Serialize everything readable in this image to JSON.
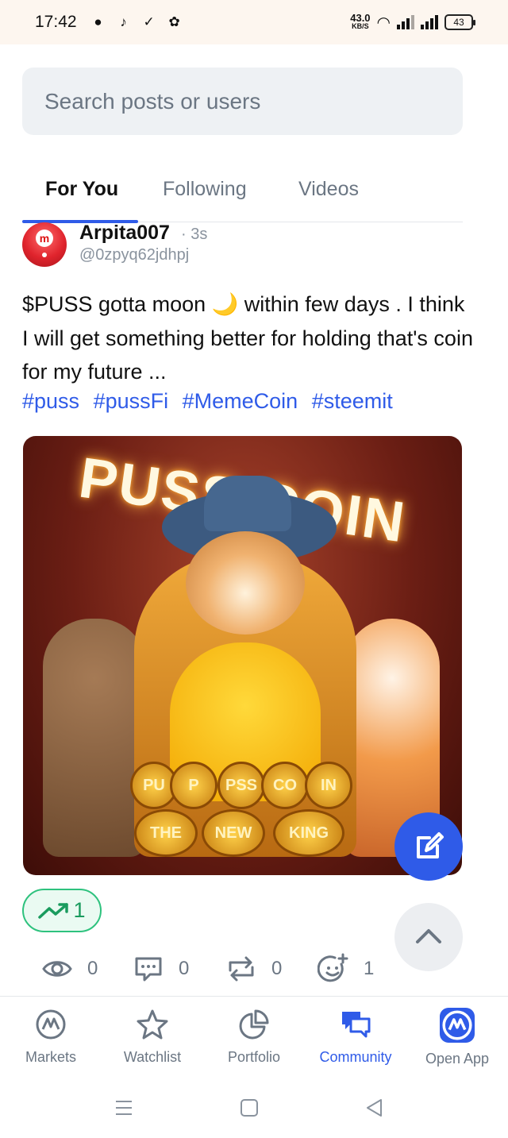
{
  "status_bar": {
    "time": "17:42",
    "net_speed": "43.0",
    "net_unit": "KB/S",
    "battery": "43"
  },
  "search": {
    "placeholder": "Search posts or users"
  },
  "tabs": [
    {
      "label": "For You",
      "active": true
    },
    {
      "label": "Following",
      "active": false
    },
    {
      "label": "Videos",
      "active": false
    }
  ],
  "post": {
    "author": "Arpita007",
    "time": "· 3s",
    "handle": "@0zpyq62jdhpj",
    "text": "$PUSS gotta moon 🌙 within few days . I think I will get something better for holding that's coin for my future ...",
    "hashtags": [
      "#puss",
      "#pussFi",
      "#MemeCoin",
      "#steemit"
    ],
    "image_text": {
      "title": "PUSS COIN",
      "coin_row1": [
        "PU",
        "P",
        "PSS",
        "CO",
        "IN"
      ],
      "coin_row2": [
        "THE",
        "NEW",
        "KING"
      ]
    },
    "trend_count": "1",
    "stats": {
      "views": "0",
      "comments": "0",
      "reposts": "0",
      "reactions": "1"
    }
  },
  "bottom_nav": [
    {
      "label": "Markets",
      "icon": "markets-icon",
      "active": false
    },
    {
      "label": "Watchlist",
      "icon": "star-icon",
      "active": false
    },
    {
      "label": "Portfolio",
      "icon": "pie-chart-icon",
      "active": false
    },
    {
      "label": "Community",
      "icon": "chat-icon",
      "active": true
    },
    {
      "label": "Open App",
      "icon": "app-logo-icon",
      "active": false
    }
  ],
  "colors": {
    "accent": "#2f5be8",
    "trend_green": "#1a9b5e",
    "muted": "#6b7683"
  }
}
